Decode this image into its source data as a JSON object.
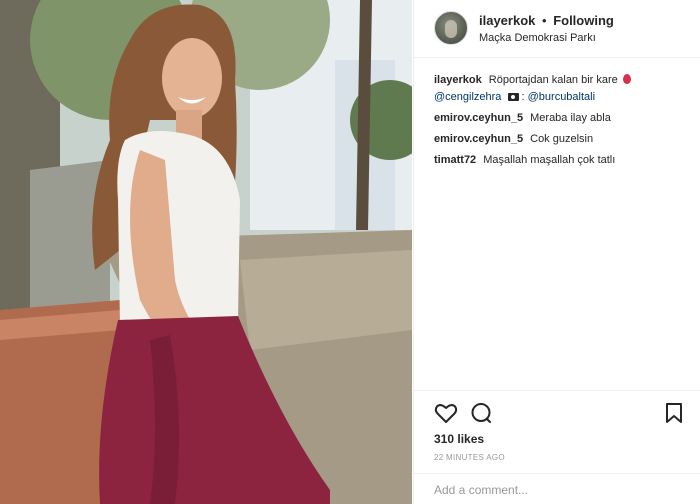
{
  "post": {
    "username": "ilayerkok",
    "separator": "•",
    "follow_status": "Following",
    "location": "Maçka Demokrasi Parkı"
  },
  "caption": {
    "username": "ilayerkok",
    "text_before": "Röportajdan kalan bir kare",
    "mention_1": "@cengilzehra",
    "mention_2": "@burcubaltali"
  },
  "comments": [
    {
      "username": "emirov.ceyhun_5",
      "text": "Meraba ilay abla"
    },
    {
      "username": "emirov.ceyhun_5",
      "text": "Cok guzelsin"
    },
    {
      "username": "timatt72",
      "text": "Maşallah maşallah çok tatlı"
    }
  ],
  "actions": {
    "likes": "310 likes",
    "timestamp": "22 MINUTES AGO",
    "add_comment_placeholder": "Add a comment..."
  },
  "icons": {
    "like": "heart-icon",
    "comment": "comment-bubble-icon",
    "save": "bookmark-icon",
    "caption_emoji_1": "balloon-icon",
    "caption_emoji_2": "camera-icon"
  }
}
